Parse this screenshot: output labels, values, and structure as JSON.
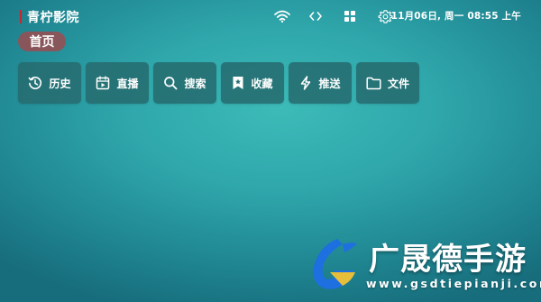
{
  "app": {
    "title": "青柠影院"
  },
  "status_bar": {
    "icons": [
      "wifi-icon",
      "code-icon",
      "grid-icon",
      "gear-icon"
    ],
    "datetime": "11月06日, 周一 08:55 上午"
  },
  "nav": {
    "home_tab": "首页"
  },
  "menu": {
    "items": [
      {
        "label": "历史",
        "icon": "history-icon"
      },
      {
        "label": "直播",
        "icon": "live-tv-icon"
      },
      {
        "label": "搜索",
        "icon": "search-icon"
      },
      {
        "label": "收藏",
        "icon": "bookmark-star-icon"
      },
      {
        "label": "推送",
        "icon": "lightning-icon"
      },
      {
        "label": "文件",
        "icon": "folder-icon"
      }
    ]
  },
  "watermark": {
    "title": "广晟德手游",
    "url": "www.gsdtiepianji.com",
    "accent": "#1e6fe0"
  },
  "colors": {
    "background": "#2fa7ab",
    "brand_accent": "#c8272d",
    "home_tab": "#964e52",
    "menu_button": "#266c70"
  }
}
